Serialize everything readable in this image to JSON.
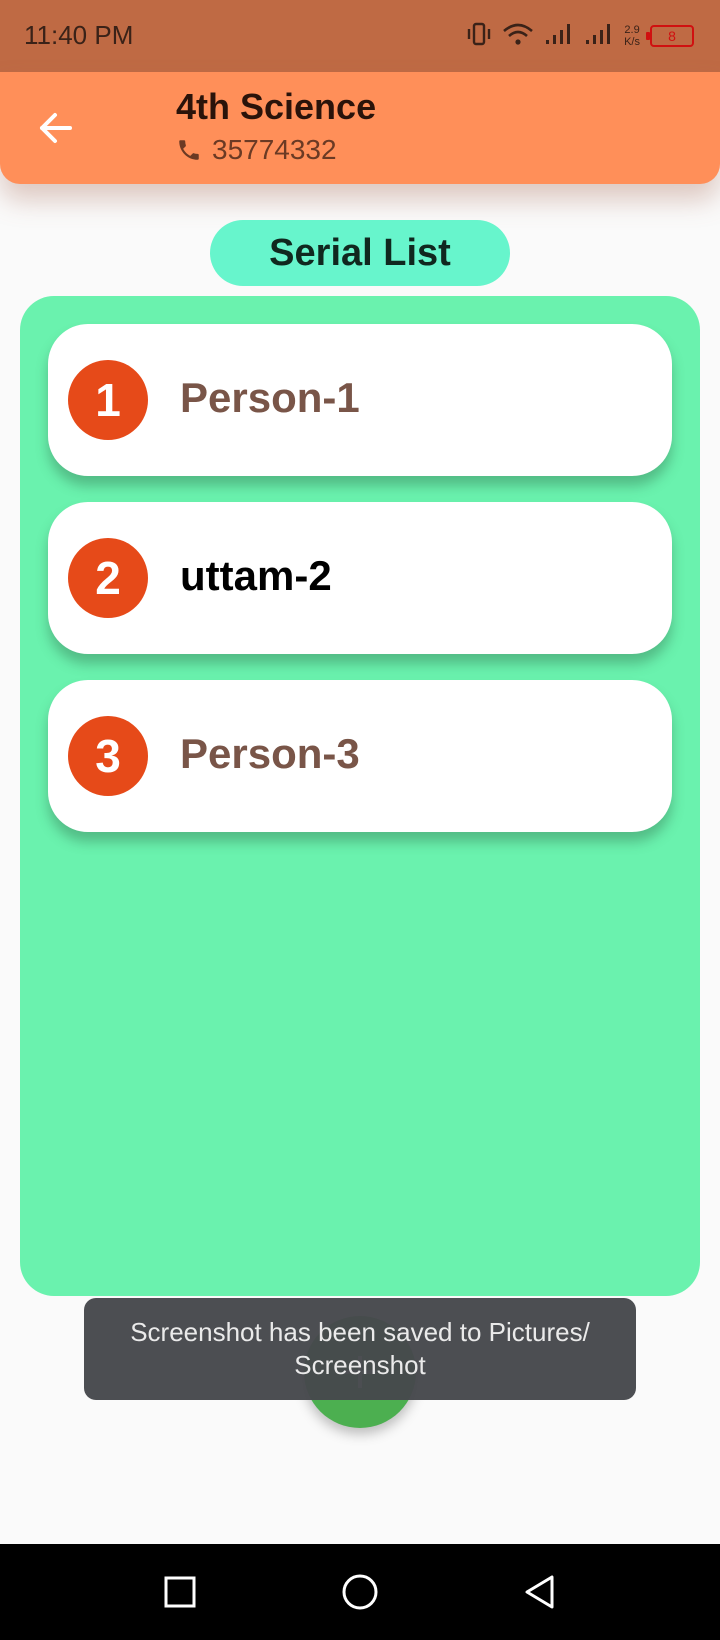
{
  "status_bar": {
    "time": "11:40 PM",
    "net_speed_value": "2.9",
    "net_speed_unit": "K/s",
    "battery_level": "8",
    "icons": [
      "vibrate-icon",
      "wifi-icon",
      "signal-icon",
      "signal-icon",
      "battery-icon"
    ]
  },
  "app_bar": {
    "back_icon": "arrow-left-icon",
    "title": "4th Science",
    "phone_icon": "phone-icon",
    "phone": "35774332"
  },
  "serial_list": {
    "heading": "Serial List",
    "items": [
      {
        "number": "1",
        "name": "Person-1",
        "name_color": "#795548"
      },
      {
        "number": "2",
        "name": "uttam-2",
        "name_color": "#000000"
      },
      {
        "number": "3",
        "name": "Person-3",
        "name_color": "#795548"
      }
    ]
  },
  "fab": {
    "icon": "add-icon"
  },
  "toast": {
    "line1": "Screenshot has been saved to  Pictures/",
    "line2": "Screenshot"
  },
  "nav_bar": {
    "icons": [
      "recent-apps-icon",
      "home-icon",
      "back-icon"
    ]
  },
  "colors": {
    "app_bar": "#ff8f59",
    "status_bar": "#bf6a44",
    "pill": "#67f5cc",
    "panel": "#6af2ae",
    "badge": "#e64a19",
    "fab": "#4caf50"
  }
}
